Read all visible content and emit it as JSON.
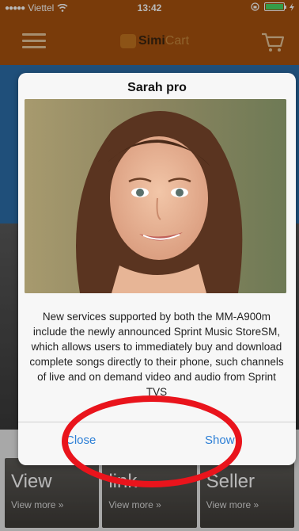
{
  "status_bar": {
    "carrier": "Viettel",
    "time": "13:42"
  },
  "nav": {
    "logo_primary": "Simi",
    "logo_secondary": "Cart"
  },
  "background_tiles": [
    {
      "title": "View",
      "more": "View more »"
    },
    {
      "title": "link",
      "more": "View more »"
    },
    {
      "title": "Seller",
      "more": "View more »"
    }
  ],
  "dialog": {
    "title": "Sarah pro",
    "description": "New services supported by both the MM-A900m include the newly announced Sprint Music StoreSM, which allows users to immediately buy and download complete songs directly to their phone, such channels of live and on demand video and audio from Sprint TVS",
    "close_label": "Close",
    "show_label": "Show"
  },
  "colors": {
    "brand_orange": "#a8520f",
    "link_blue": "#2d7fd6",
    "annotation_red": "#e9141c"
  }
}
